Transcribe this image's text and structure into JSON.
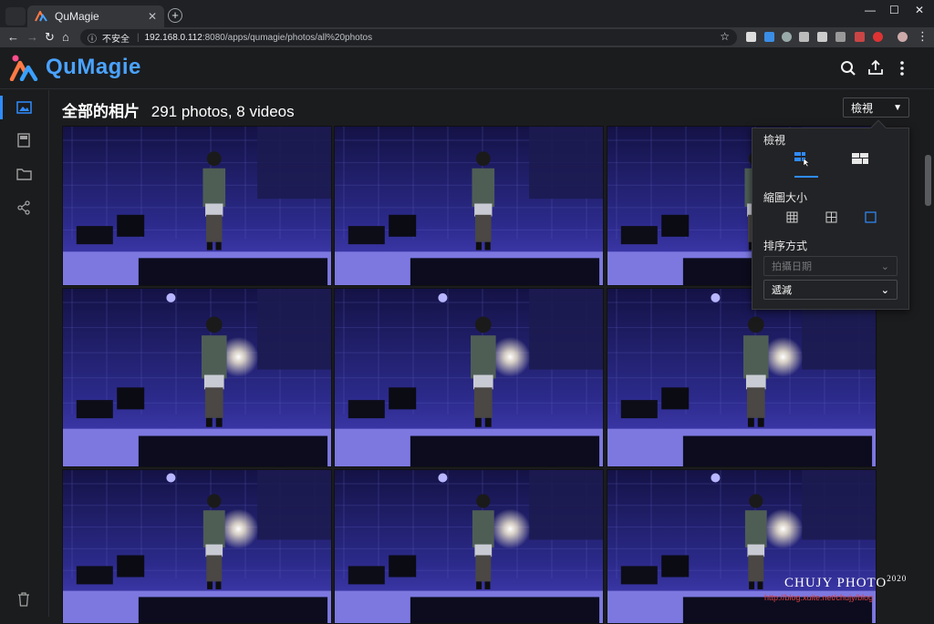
{
  "browser": {
    "tab_title": "QuMagie",
    "tab_close": "✕",
    "new_tab": "+",
    "security_label": "不安全",
    "url_host": "192.168.0.112",
    "url_rest": ":8080/apps/qumagie/photos/all%20photos",
    "window_controls": [
      "—",
      "☐",
      "✕"
    ]
  },
  "app": {
    "brand": "QuMagie",
    "heading_title": "全部的相片",
    "heading_count": "291 photos, 8 videos",
    "view_button": "檢視"
  },
  "popover": {
    "view_label": "檢視",
    "thumb_size_label": "縮圖大小",
    "sort_label": "排序方式",
    "sort_field": "拍攝日期",
    "sort_order": "遞減"
  },
  "watermark": {
    "name": "CHUJY PHOTO",
    "year": "2020",
    "url": "http://blog.xuite.net/chujy/blog"
  },
  "colors": {
    "accent": "#2f8cff",
    "brand": "#4aa3ff",
    "background": "#1b1c1e"
  },
  "icons": {
    "sidebar": [
      "photos-icon",
      "album-icon",
      "folder-icon",
      "share-icon",
      "trash-icon"
    ],
    "appbar": [
      "search-icon",
      "upload-icon",
      "more-icon"
    ]
  }
}
